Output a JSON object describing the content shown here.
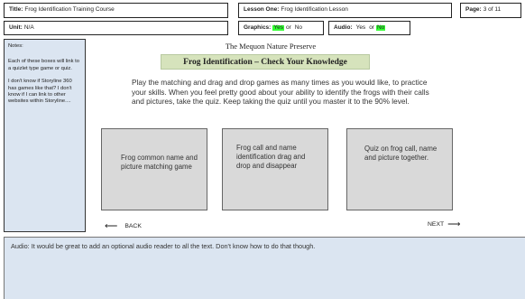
{
  "header": {
    "title_label": "Title:",
    "title_value": "Frog Identification Training Course",
    "lesson_label": "Lesson One:",
    "lesson_value": "Frog Identification Lesson",
    "page_label": "Page:",
    "page_value": "3 of 11",
    "unit_label": "Unit:",
    "unit_value": "N/A",
    "graphics_label": "Graphics:",
    "graphics_yes": "Yes",
    "graphics_or": "or",
    "graphics_no": "No",
    "audio_label": "Audio:",
    "audio_yes": "Yes",
    "audio_or": "or",
    "audio_no": "No",
    "highlight_color": "#33ff33"
  },
  "notes": {
    "title": "Notes:",
    "paragraphs": [
      "Each of these boxes will link to a quizlet type game or quiz.",
      "I don't know if Storyline 360 has games like that? I don't know if I can link to other websites within Storyline...."
    ],
    "background": "#dbe5f1"
  },
  "main": {
    "subtitle": "The Mequon Nature Preserve",
    "banner": "Frog Identification – Check Your Knowledge",
    "banner_color": "#d6e3bc",
    "instructions": "Play the matching and drag and drop games as many times as you would like, to practice your skills. When you feel pretty good about your ability to identify the frogs with their calls and pictures, take the quiz. Keep taking the quiz until you master it to the 90% level.",
    "cards": [
      "Frog common name and picture matching game",
      "Frog call and name identification drag and drop and disappear",
      "Quiz on frog call, name and picture together."
    ],
    "back_label": "BACK",
    "next_label": "NEXT"
  },
  "audio_note": "Audio: It would be great to add an optional audio reader to all the text. Don't know how to do that though."
}
